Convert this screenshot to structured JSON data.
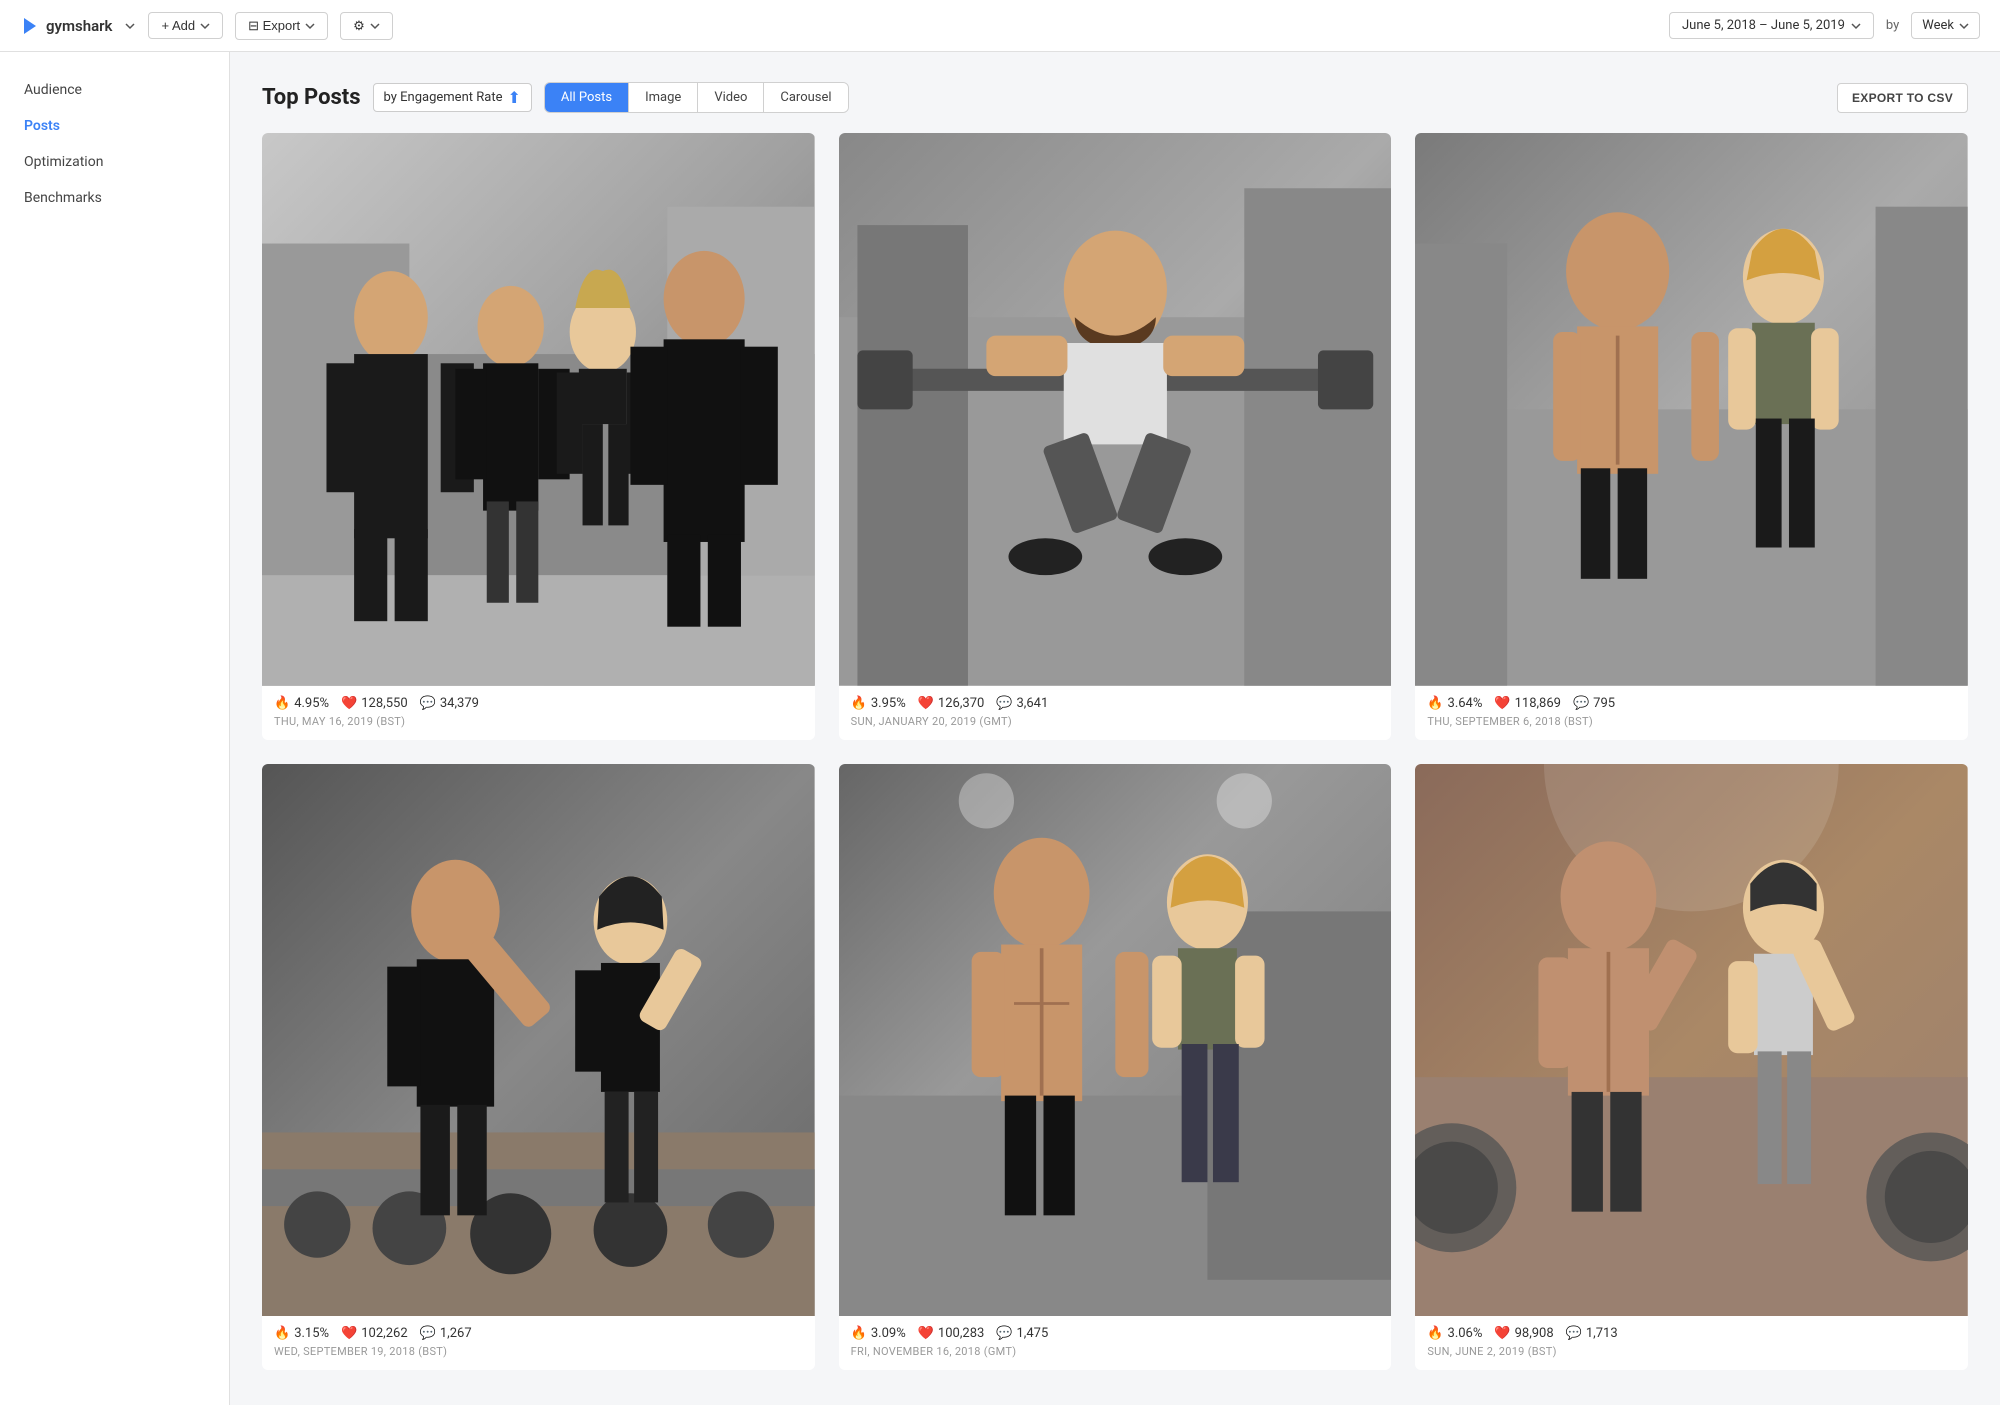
{
  "app": {
    "logo": "gymshark",
    "logo_icon": "▷"
  },
  "topnav": {
    "logo_label": "gymshark",
    "dropdown_label": "",
    "add_label": "+ Add",
    "export_label": "⊟ Export",
    "settings_label": "⚙",
    "date_range": "June 5, 2018 – June 5, 2019",
    "by_label": "by",
    "week_label": "Week"
  },
  "sidebar": {
    "items": [
      {
        "id": "audience",
        "label": "Audience",
        "active": false
      },
      {
        "id": "posts",
        "label": "Posts",
        "active": true
      },
      {
        "id": "optimization",
        "label": "Optimization",
        "active": false
      },
      {
        "id": "benchmarks",
        "label": "Benchmarks",
        "active": false
      }
    ]
  },
  "section": {
    "title": "Top Posts",
    "engagement_label": "by Engagement Rate",
    "export_csv_label": "EXPORT TO CSV"
  },
  "filter_tabs": [
    {
      "id": "all",
      "label": "All Posts",
      "active": true
    },
    {
      "id": "image",
      "label": "Image",
      "active": false
    },
    {
      "id": "video",
      "label": "Video",
      "active": false
    },
    {
      "id": "carousel",
      "label": "Carousel",
      "active": false
    }
  ],
  "posts": [
    {
      "id": 1,
      "engagement": "4.95%",
      "likes": "128,550",
      "comments": "34,379",
      "date": "THU, MAY 16, 2019 (BST)",
      "img_class": "img-1",
      "bg_color1": "#1a1a2e",
      "bg_color2": "#4a4a6a",
      "accent": "#888"
    },
    {
      "id": 2,
      "engagement": "3.95%",
      "likes": "126,370",
      "comments": "3,641",
      "date": "SUN, JANUARY 20, 2019 (GMT)",
      "img_class": "img-2",
      "bg_color1": "#2a2a2a",
      "bg_color2": "#666",
      "accent": "#999"
    },
    {
      "id": 3,
      "engagement": "3.64%",
      "likes": "118,869",
      "comments": "795",
      "date": "THU, SEPTEMBER 6, 2018 (BST)",
      "img_class": "img-3",
      "bg_color1": "#3a3535",
      "bg_color2": "#777",
      "accent": "#aaa"
    },
    {
      "id": 4,
      "engagement": "3.15%",
      "likes": "102,262",
      "comments": "1,267",
      "date": "WED, SEPTEMBER 19, 2018 (BST)",
      "img_class": "img-4",
      "bg_color1": "#222",
      "bg_color2": "#555",
      "accent": "#888"
    },
    {
      "id": 5,
      "engagement": "3.09%",
      "likes": "100,283",
      "comments": "1,475",
      "date": "FRI, NOVEMBER 16, 2018 (GMT)",
      "img_class": "img-5",
      "bg_color1": "#2a2a2a",
      "bg_color2": "#666",
      "accent": "#999"
    },
    {
      "id": 6,
      "engagement": "3.06%",
      "likes": "98,908",
      "comments": "1,713",
      "date": "SUN, JUNE 2, 2019 (BST)",
      "img_class": "img-6",
      "bg_color1": "#3a2a2a",
      "bg_color2": "#886655",
      "accent": "#bbb"
    }
  ]
}
